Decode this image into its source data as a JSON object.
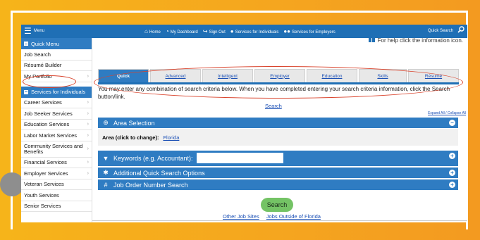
{
  "topbar": {
    "menu_label": "Menu",
    "nav": [
      {
        "icon": "home-icon",
        "glyph": "⌂",
        "label": "Home"
      },
      {
        "icon": "dashboard-icon",
        "glyph": "◔",
        "label": "My Dashboard"
      },
      {
        "icon": "signout-icon",
        "glyph": "↪",
        "label": "Sign Out"
      },
      {
        "icon": "person-icon",
        "glyph": "👤",
        "label": "Services for Individuals"
      },
      {
        "icon": "people-icon",
        "glyph": "👥",
        "label": "Services for Employers"
      }
    ],
    "quick_search_label": "Quick Search"
  },
  "sidebar": {
    "quick_menu_title": "Quick Menu",
    "quick_items": [
      {
        "label": "Job Search",
        "chevron": ""
      },
      {
        "label": "Résumé Builder",
        "chevron": ""
      },
      {
        "label": "My Portfolio",
        "chevron": "›"
      }
    ],
    "services_title": "Services for Individuals",
    "service_items": [
      {
        "label": "Career Services",
        "chevron": "›"
      },
      {
        "label": "Job Seeker Services",
        "chevron": "›"
      },
      {
        "label": "Education Services",
        "chevron": "›"
      },
      {
        "label": "Labor Market Services",
        "chevron": "›"
      },
      {
        "label": "Community Services and Benefits",
        "chevron": "›"
      },
      {
        "label": "Financial Services",
        "chevron": "›"
      },
      {
        "label": "Employer Services",
        "chevron": "›"
      },
      {
        "label": "Veteran Services",
        "chevron": ""
      },
      {
        "label": "Youth Services",
        "chevron": ""
      },
      {
        "label": "Senior Services",
        "chevron": ""
      }
    ]
  },
  "main": {
    "help_text": "For help click the information icon.",
    "tabs": [
      "Quick",
      "Advanced",
      "Intelligent",
      "Employer",
      "Education",
      "Skills",
      "Résumé"
    ],
    "intro": "You may enter any combination of search criteria below. When you have completed entering your search criteria information, click the Search button/link.",
    "search_link": "Search",
    "expand_collapse": "Expand All / Collapse All",
    "area_selection": "Area Selection",
    "area_label": "Area (click to change):",
    "area_value": "Florida",
    "keywords_label": "Keywords (e.g. Accountant):",
    "keywords_value": "",
    "additional_options": "Additional Quick Search Options",
    "job_order": "Job Order Number Search",
    "search_button": "Search",
    "other_sites": "Other Job Sites",
    "outside_florida": "Jobs Outside of Florida"
  },
  "colors": {
    "accent": "#2f7cc2",
    "background": "#f6b41a",
    "annotation": "#d9442d",
    "search_button": "#74c365"
  }
}
